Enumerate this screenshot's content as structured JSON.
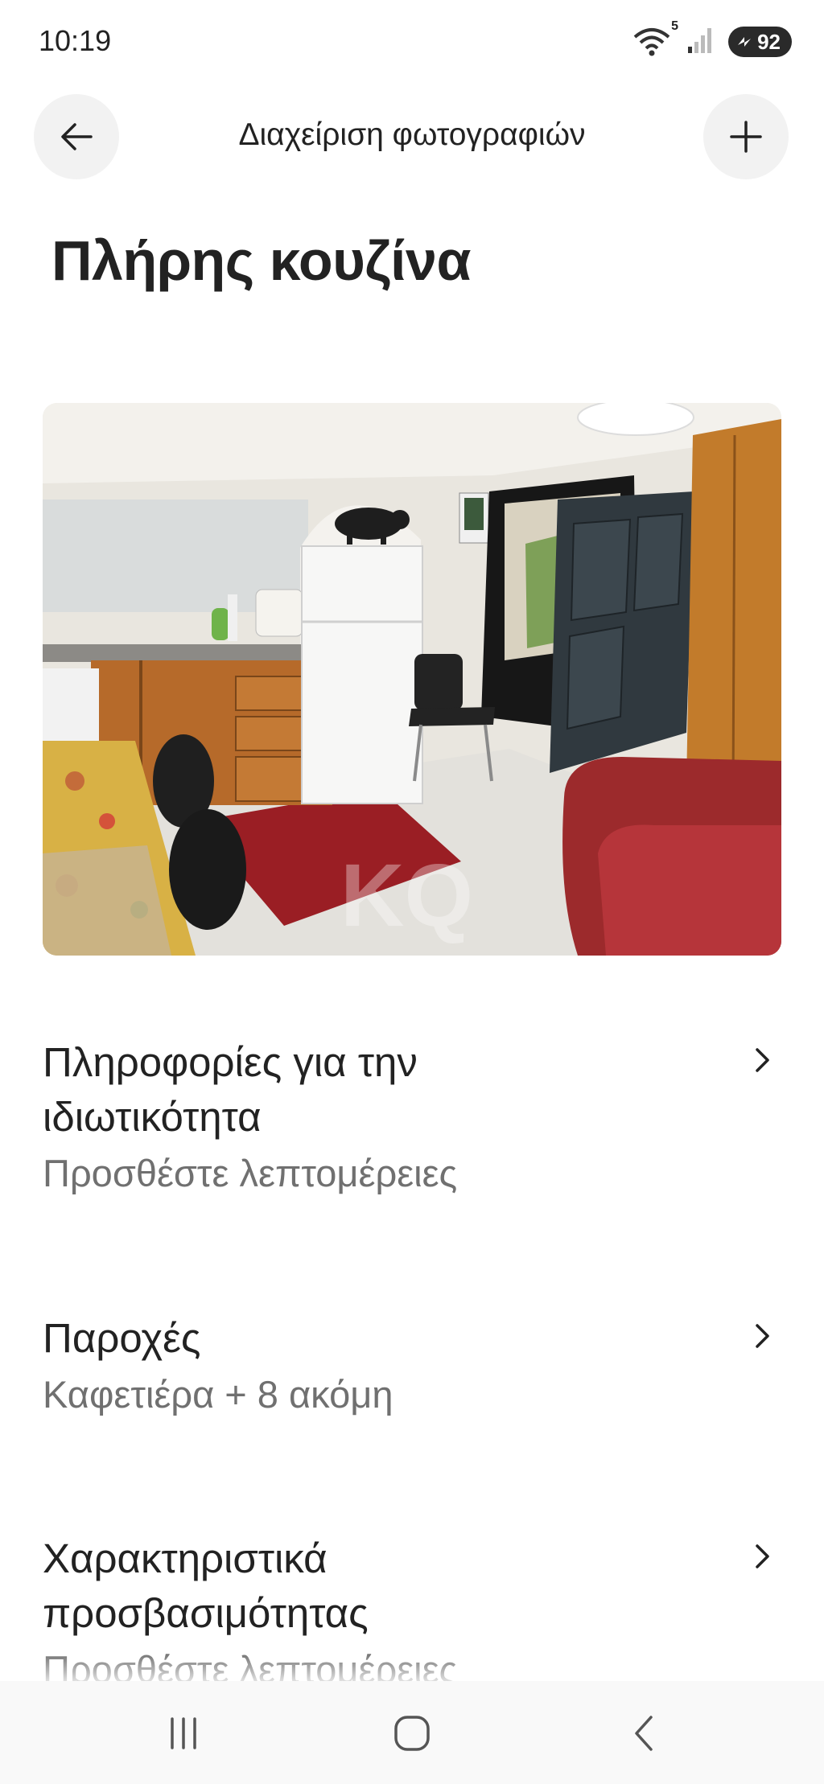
{
  "status_bar": {
    "time": "10:19",
    "wifi_badge": "5",
    "battery": "92",
    "icons": [
      "wifi-icon",
      "signal-icon",
      "battery-icon"
    ]
  },
  "header": {
    "title": "Διαχείριση φωτογραφιών",
    "back_icon": "arrow-left-icon",
    "add_icon": "plus-icon"
  },
  "page": {
    "title": "Πλήρης κουζίνα"
  },
  "photo": {
    "watermark": "KQ"
  },
  "rows": [
    {
      "title_line1": "Πληροφορίες για την",
      "title_line2": "ιδιωτικότητα",
      "subtitle": "Προσθέστε λεπτομέρειες"
    },
    {
      "title_line1": "Παροχές",
      "subtitle": "Καφετιέρα + 8 ακόμη"
    },
    {
      "title_line1": "Χαρακτηριστικά",
      "title_line2": "προσβασιμότητας",
      "subtitle": "Προσθέστε λεπτομέρειες"
    }
  ],
  "nav": {
    "icons": [
      "recent-apps-icon",
      "home-icon",
      "back-icon"
    ]
  },
  "colors": {
    "text": "#222222",
    "secondary_text": "#707070",
    "button_bg": "#f2f2f2"
  }
}
